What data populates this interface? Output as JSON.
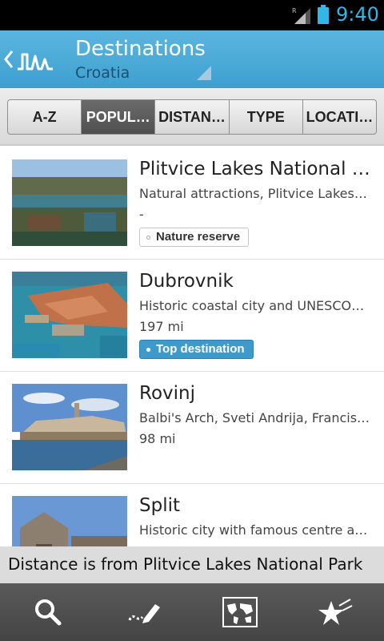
{
  "status_bar": {
    "time": "9:40",
    "signal_icon": "signal-roaming-icon",
    "battery_icon": "battery-icon",
    "accent_color": "#33b5e5"
  },
  "action_bar": {
    "title": "Destinations",
    "subtitle": "Croatia",
    "back_icon": "chevron-left-icon",
    "logo_icon": "app-logo-icon",
    "spinner_icon": "dropdown-corner-icon"
  },
  "tabs": [
    {
      "label": "A-Z",
      "active": false
    },
    {
      "label": "POPUL…",
      "active": true
    },
    {
      "label": "DISTAN…",
      "active": false
    },
    {
      "label": "TYPE",
      "active": false
    },
    {
      "label": "LOCATI…",
      "active": false
    }
  ],
  "destinations": [
    {
      "title": "Plitvice Lakes National P…",
      "description": "Natural attractions, Plitvice Lakes…",
      "distance": "-",
      "badge": "Nature reserve",
      "badge_style": "outline"
    },
    {
      "title": "Dubrovnik",
      "description": "Historic coastal city and UNESCO…",
      "distance": "197 mi",
      "badge": "Top destination",
      "badge_style": "filled"
    },
    {
      "title": "Rovinj",
      "description": "Balbi's Arch, Sveti Andrija, Francisc…",
      "distance": "98 mi",
      "badge": "",
      "badge_style": ""
    },
    {
      "title": "Split",
      "description": "Historic city with famous centre an…",
      "distance": "",
      "badge": "",
      "badge_style": ""
    }
  ],
  "info_banner": "Distance is from Plitvice Lakes National Park",
  "bottom_bar": {
    "buttons": [
      {
        "icon": "search-icon"
      },
      {
        "icon": "pencil-route-icon"
      },
      {
        "icon": "world-map-icon"
      },
      {
        "icon": "star-favorites-icon"
      }
    ]
  }
}
